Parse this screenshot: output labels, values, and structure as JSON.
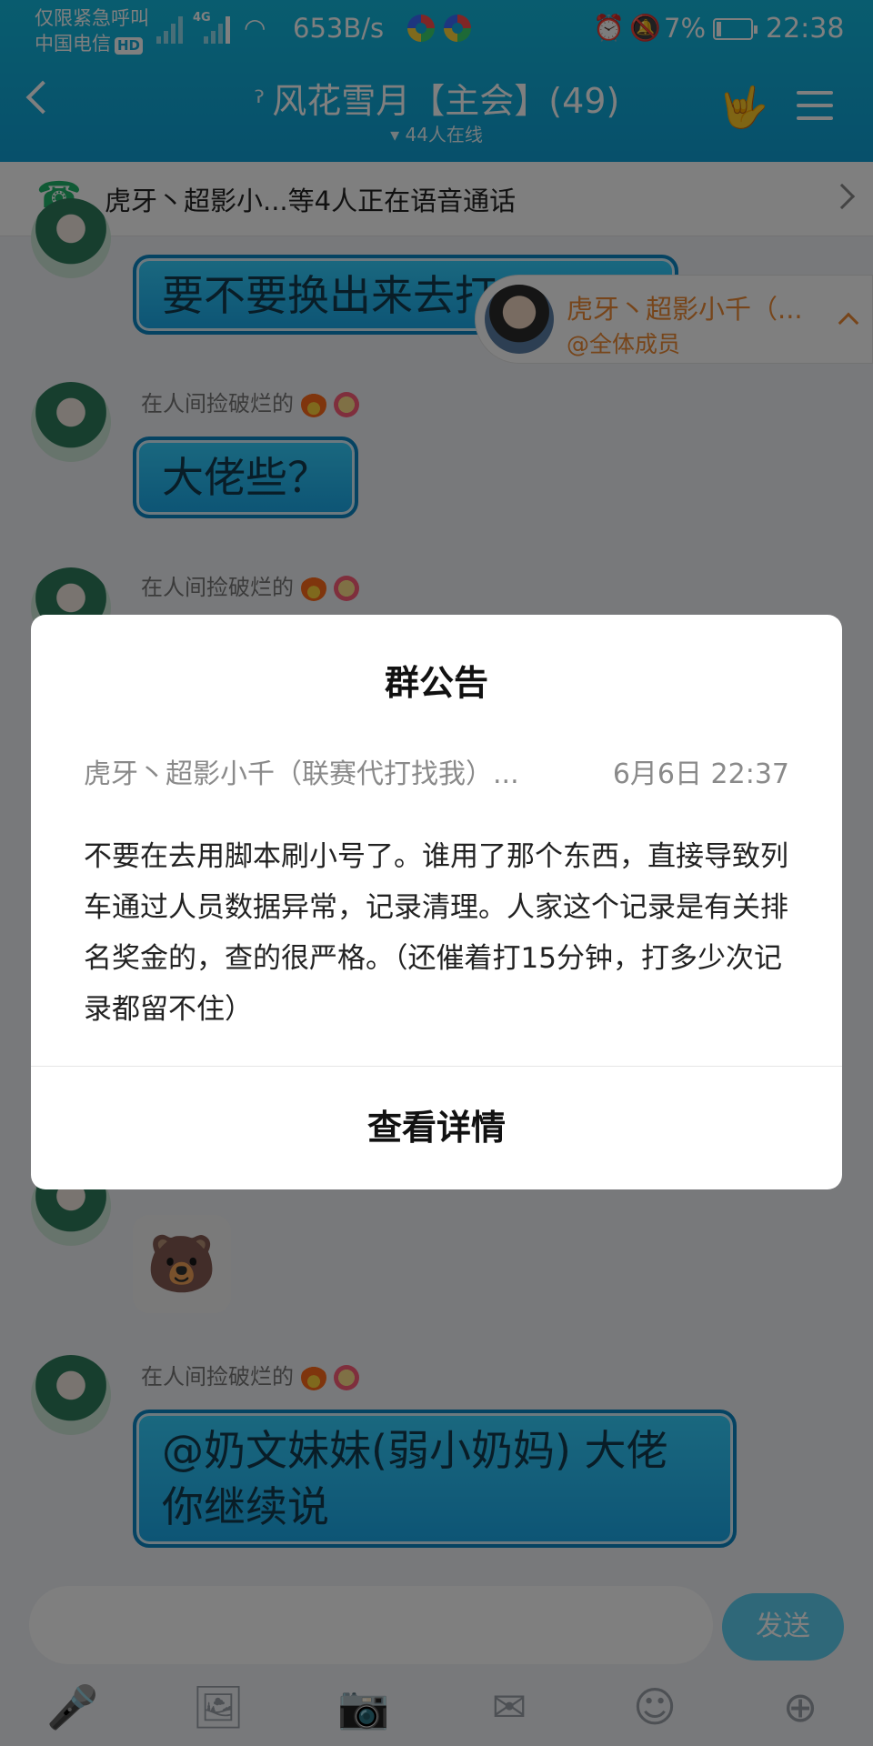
{
  "status_bar": {
    "carrier_line1": "仅限紧急呼叫",
    "carrier_line2": "中国电信",
    "hd": "HD",
    "network": "4G",
    "speed": "653B/s",
    "battery": "7%",
    "time": "22:38"
  },
  "header": {
    "title": "风花雪月【主会】(49)",
    "online": "44人在线"
  },
  "voice_bar": {
    "text": "虎牙丶超影小...等4人正在语音通话"
  },
  "messages": [
    {
      "user": "",
      "text": "要不要换出来去打"
    },
    {
      "user": "在人间捡破烂的",
      "text": "大佬些？"
    },
    {
      "user": "在人间捡破烂的",
      "text": ""
    },
    {
      "user": "",
      "text": "",
      "sticker": "bear-sticker"
    },
    {
      "user": "在人间捡破烂的",
      "text": "@奶文妹妹(弱小奶妈) 大佬你继续说"
    }
  ],
  "mention_pill": {
    "name": "虎牙丶超影小千（...",
    "sub": "@全体成员"
  },
  "input_bar": {
    "send_label": "发送",
    "tools": [
      "mic-icon",
      "image-icon",
      "camera-icon",
      "redpacket-icon",
      "emoji-icon",
      "plus-icon"
    ]
  },
  "dialog": {
    "title": "群公告",
    "author": "虎牙丶超影小千（联赛代打找我）...",
    "time": "6月6日 22:37",
    "body": "不要在去用脚本刷小号了。谁用了那个东西，直接导致列车通过人员数据异常，记录清理。人家这个记录是有关排名奖金的，查的很严格。（还催着打15分钟，打多少次记录都留不住）",
    "action": "查看详情"
  }
}
